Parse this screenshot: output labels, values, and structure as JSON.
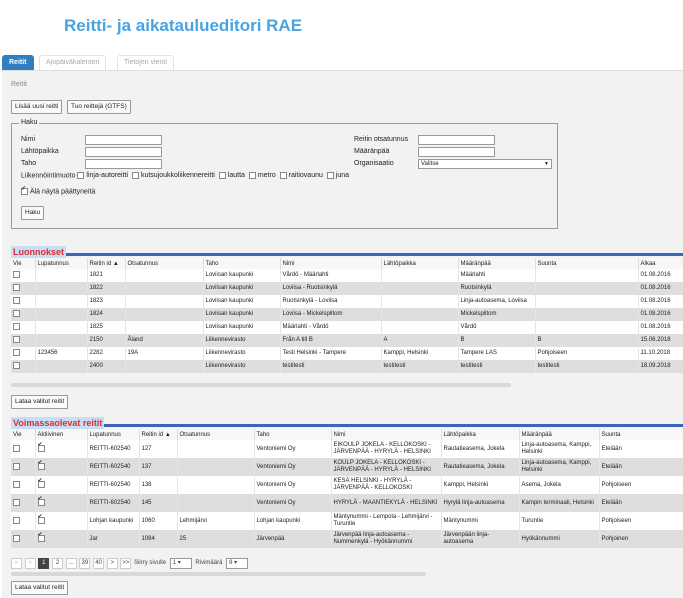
{
  "app": {
    "title": "Reitti- ja aikataulueditori RAE"
  },
  "tabs": [
    {
      "label": "Reitit"
    },
    {
      "label": "Ajopäiväkalenteri"
    },
    {
      "label": "Tietojen vienti"
    }
  ],
  "breadcrumb": "Reitit",
  "toolbar": {
    "add_route": "Lisää uusi reitti",
    "import_gtfs": "Tuo reittejä (GTFS)"
  },
  "search": {
    "legend": "Haku",
    "name_label": "Nimi",
    "origin_label": "Lähtöpaikka",
    "stop_label": "Taho",
    "transport_label": "Liikennöintimuoto",
    "header_label": "Reitin otsatunnus",
    "destination_label": "Määränpää",
    "organization_label": "Organisaatio",
    "organization_value": "Valitse",
    "modes": [
      "linja-autoreitti",
      "kutsujoukkoliikennereitti",
      "lautta",
      "metro",
      "raitiovaunu",
      "juna"
    ],
    "hide_ended_label": "Älä näytä päättyneitä",
    "search_button": "Haku"
  },
  "drafts": {
    "title": "Luonnokset",
    "columns": [
      "Vie",
      "Lupatunnus",
      "Reitin id",
      "Otsatunnus",
      "Taho",
      "Nimi",
      "Lähtöpaikka",
      "Määränpää",
      "Suunta",
      "Alkaa"
    ],
    "rows": [
      [
        "",
        "",
        "1821",
        "",
        "Loviisan kaupunki",
        "Vårdö - Määrlahti",
        "",
        "Määrlahti",
        "",
        "01.08.2016"
      ],
      [
        "",
        "",
        "1822",
        "",
        "Loviisan kaupunki",
        "Loviisa - Ruotsinkylä",
        "",
        "Ruotsinkylä",
        "",
        "01.08.2016"
      ],
      [
        "",
        "",
        "1823",
        "",
        "Loviisan kaupunki",
        "Ruotsinkylä - Loviisa",
        "",
        "Linja-autoasema, Loviisa",
        "",
        "01.08.2016"
      ],
      [
        "",
        "",
        "1824",
        "",
        "Loviisan kaupunki",
        "Loviisa - Mickelspiltom",
        "",
        "Mickelspiltom",
        "",
        "01.08.2016"
      ],
      [
        "",
        "",
        "1825",
        "",
        "Loviisan kaupunki",
        "Määrlahti - Vårdö",
        "",
        "Vårdö",
        "",
        "01.08.2016"
      ],
      [
        "",
        "",
        "2150",
        "Åland",
        "Liikennevirasto",
        "Från A till B",
        "A",
        "B",
        "B",
        "15.06.2018"
      ],
      [
        "",
        "123456",
        "2282",
        "19A",
        "Liikennevirasto",
        "Testi Helsinki - Tampere",
        "Kamppi, Helsinki",
        "Tampere LAS",
        "Pohjoiseen",
        "11.10.2018"
      ],
      [
        "",
        "",
        "2400",
        "",
        "Liikennevirasto",
        "testitesti",
        "testitesti",
        "testitesti",
        "testitesti",
        "18.09.2018"
      ]
    ],
    "load_button": "Lataa valitut reitit"
  },
  "active": {
    "title": "Voimassaolevat reitit",
    "columns": [
      "Vie",
      "Aktiivinen",
      "Lupatunnus",
      "Reitin id",
      "Otsatunnus",
      "Taho",
      "Nimi",
      "Lähtöpaikka",
      "Määränpää",
      "Suunta"
    ],
    "rows": [
      [
        "",
        "✔",
        "REITTI-602540",
        "127",
        "",
        "Ventoniemi Oy",
        "EIKOULP JOKELA - KELLOKOSKI - JÄRVENPÄÄ - HYRYLÄ - HELSINKI",
        "Rautatieasema, Jokela",
        "Linja-autoasema, Kamppi, Helsinki",
        "Etelään"
      ],
      [
        "",
        "✔",
        "REITTI-602540",
        "137",
        "",
        "Ventoniemi Oy",
        "KOULP JOKELA - KELLOKOSKI - JÄRVENPÄÄ - HYRYLÄ - HELSINKI",
        "Rautatieasema, Jokela",
        "Linja-autoasema, Kamppi, Helsinki",
        "Etelään"
      ],
      [
        "",
        "✔",
        "REITTI-602540",
        "138",
        "",
        "Ventoniemi Oy",
        "KESÄ HELSINKI - HYRYLÄ - JÄRVENPÄÄ - KELLOKOSKI",
        "Kamppi, Helsinki",
        "Asema, Jokela",
        "Pohjoiseen"
      ],
      [
        "",
        "✔",
        "REITTI-602540",
        "145",
        "",
        "Ventoniemi Oy",
        "HYRYLÄ - MAANTIEKYLÄ - HELSINKI",
        "Hyrylä linja-autoasema",
        "Kampin terminaali, Helsinki",
        "Etelään"
      ],
      [
        "",
        "✔",
        "Lohjan kaupunki",
        "1060",
        "Lehmijärvi",
        "Lohjan kaupunki",
        "Mäntynummi - Lempola - Lehmijärvi - Turuntie",
        "Mäntynummi",
        "Turuntie",
        "Pohjoiseen"
      ],
      [
        "",
        "✔",
        "Jar",
        "1084",
        "25",
        "Järvenpää",
        "Järvenpää linja-autoasema - Nummenkylä - Hyökännummi",
        "Järvenpään linja-autoasema",
        "Hyökännummi",
        "Pohjoinen"
      ]
    ],
    "pager": {
      "first": "«",
      "prev": "<",
      "pages": [
        "1",
        "2",
        "...",
        "39",
        "40"
      ],
      "next": ">",
      "last": ">>",
      "goto_label": "Siirry sivulle",
      "goto_value": "1",
      "rows_label": "Rivimäärä",
      "rows_value": "8"
    },
    "load_button": "Lataa valitut reitit"
  },
  "colors": {
    "title": "#4aa3e0",
    "tab_active": "#2f7ec0",
    "section_title": "#d83030",
    "section_bar": "#3a66b5"
  }
}
